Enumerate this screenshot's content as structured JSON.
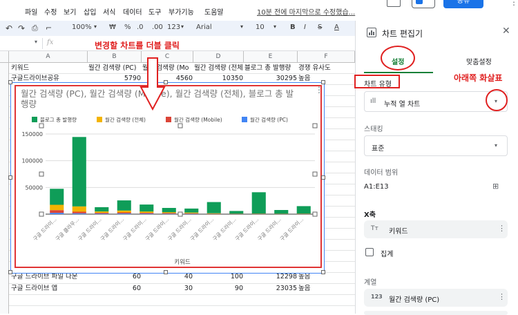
{
  "menu": {
    "items": [
      "파일",
      "수정",
      "보기",
      "삽입",
      "서식",
      "데이터",
      "도구",
      "부가기능",
      "도움말"
    ],
    "last_edit": "10분 전에 마지막으로 수정했습...",
    "share_label": "공유"
  },
  "toolbar": {
    "zoom": "100%",
    "currency": "₩",
    "percent": "%",
    "dec_less": ".0",
    "dec_more": ".00",
    "number_format": "123",
    "font": "Arial",
    "font_size": "10"
  },
  "formula": {
    "fx": "fx"
  },
  "columns": [
    "A",
    "B",
    "C",
    "D",
    "E",
    "F"
  ],
  "sheet": {
    "header_row": [
      "키워드",
      "월간 검색량 (PC)",
      "월간 검색량 (Mo",
      "월간 검색량 (전체",
      "블로그 총 발행량",
      "경쟁 유사도"
    ],
    "row2": [
      "구글드라이브공유",
      "5790",
      "4560",
      "10350",
      "30295",
      "높음"
    ],
    "row_bottom1": [
      "구글 드라이브 파일 다운",
      "60",
      "40",
      "100",
      "12298",
      "높음"
    ],
    "row_bottom2": [
      "구글 드라이브 앱",
      "60",
      "30",
      "90",
      "23035",
      "높음"
    ]
  },
  "annotations": {
    "double_click": "변경할 차트를 더블 클릭",
    "down_arrow": "아래쪽 화살표"
  },
  "chart": {
    "title": "월간 검색량 (PC), 월간 검색량 (Mobile), 월간 검색량 (전체), 블로그 총 발행량",
    "xlabel": "키워드",
    "legend": [
      "블로그 총 발행량",
      "월간 검색량 (전체)",
      "월간 검색량 (Mobile)",
      "월간 검색량 (PC)"
    ],
    "colors": {
      "blog": "#0f9d58",
      "total": "#f4b400",
      "mobile": "#db4437",
      "pc": "#4285f4"
    },
    "y_ticks": [
      "150000",
      "100000",
      "50000",
      "0"
    ]
  },
  "chart_data": {
    "type": "bar",
    "stacked": true,
    "categories": [
      "구글 드라이...",
      "구글 클라우...",
      "구글 드라이...",
      "구글 드라이...",
      "구글 드라이...",
      "구글 드라이...",
      "구글 드라이...",
      "구글 드라이...",
      "구글 드라이...",
      "구글 드라이...",
      "구글 드라이...",
      "구글 드라이..."
    ],
    "series": [
      {
        "name": "월간 검색량 (PC)",
        "values": [
          2500,
          1500,
          1000,
          1200,
          1000,
          700,
          600,
          300,
          200,
          200,
          200,
          200
        ]
      },
      {
        "name": "월간 검색량 (Mobile)",
        "values": [
          5000,
          3000,
          1500,
          2000,
          1500,
          1200,
          900,
          500,
          300,
          300,
          200,
          300
        ]
      },
      {
        "name": "월간 검색량 (전체)",
        "values": [
          10000,
          10000,
          2500,
          3500,
          2500,
          1800,
          1500,
          800,
          500,
          500,
          400,
          500
        ]
      },
      {
        "name": "블로그 총 발행량",
        "values": [
          30000,
          130000,
          8000,
          19000,
          13000,
          8000,
          7500,
          21000,
          5000,
          40000,
          7000,
          14000
        ]
      }
    ],
    "ylim": [
      0,
      150000
    ],
    "xlabel": "키워드"
  },
  "panel": {
    "title": "차트 편집기",
    "tab_setup": "설정",
    "tab_customize": "맞춤설정",
    "chart_type_label": "차트 유형",
    "chart_type_value": "누적 열 차트",
    "stacking_label": "스태킹",
    "stacking_value": "표준",
    "data_range_label": "데이터 범위",
    "data_range_value": "A1:E13",
    "x_axis_label": "X축",
    "x_axis_value": "키워드",
    "aggregate_label": "집계",
    "series_label": "계열",
    "series_value": "월간 검색량 (PC)",
    "tt_glyph": "Tт",
    "num_glyph": "123"
  }
}
